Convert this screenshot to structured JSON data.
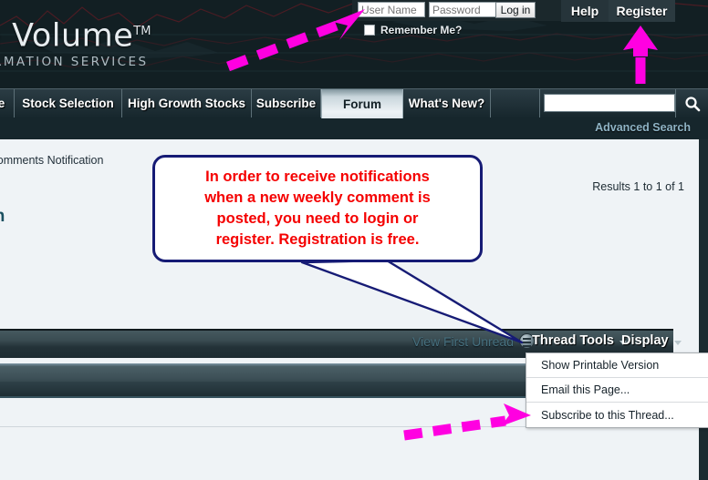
{
  "header": {
    "logo_main": "ive Volume",
    "logo_tm": "TM",
    "logo_sub": "INFORMATION SERVICES",
    "username_placeholder": "User Name",
    "username_value": "",
    "password_placeholder": "Password",
    "password_value": "",
    "login_label": "Log in",
    "remember_label": "Remember Me?",
    "help_label": "Help",
    "register_label": "Register"
  },
  "nav": {
    "tabs": [
      {
        "label": "e",
        "active": false
      },
      {
        "label": "Stock Selection",
        "active": false
      },
      {
        "label": "High Growth Stocks",
        "active": false
      },
      {
        "label": "Subscribe",
        "active": false
      },
      {
        "label": "Forum",
        "active": true
      },
      {
        "label": "What's New?",
        "active": false
      },
      {
        "label": "",
        "active": false
      }
    ],
    "search_placeholder": "",
    "search_value": "",
    "search_icon": "search-icon",
    "advanced_search_label": "Advanced Search"
  },
  "main": {
    "breadcrumb": "y Comments Notification",
    "page_title": "ation",
    "results_label": "Results 1 to 1 of 1",
    "view_first_unread": "View First Unread",
    "thread_tools_label": "Thread Tools",
    "display_label": "Display"
  },
  "dropdown": {
    "items": [
      "Show Printable Version",
      "Email this Page...",
      "Subscribe to this Thread..."
    ]
  },
  "callout": {
    "lines": [
      "In order to receive notifications",
      "when a new weekly comment is",
      "posted, you need to login or",
      "register. Registration is free."
    ],
    "text_color": "#f50000",
    "border_color": "#161b75"
  },
  "annotations": {
    "arrow_color": "#ff00e1",
    "arrow_login_name": "dashed-arrow-to-login",
    "arrow_register_name": "arrow-to-register",
    "arrow_subscribe_name": "dashed-arrow-to-subscribe"
  },
  "colors": {
    "header_bg": "#121f23",
    "nav_bg": "#213138",
    "content_bg": "#eff3f6",
    "accent_link": "#8fb4c6",
    "title_color": "#1b5060"
  }
}
